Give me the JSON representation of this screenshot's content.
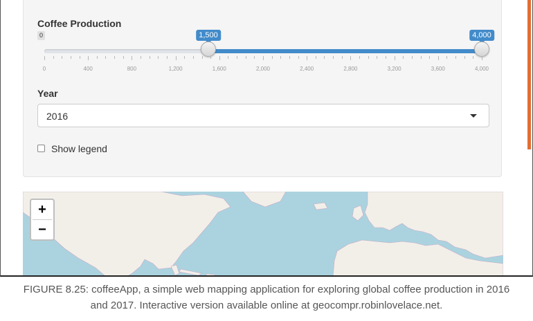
{
  "slider": {
    "label": "Coffee Production",
    "min_label": "0",
    "low_value": "1,500",
    "high_value": "4,000",
    "min": 0,
    "max": 4000,
    "low": 1500,
    "high": 4000,
    "tick_labels": [
      "0",
      "400",
      "800",
      "1,200",
      "1,600",
      "2,000",
      "2,400",
      "2,800",
      "3,200",
      "3,600",
      "4,000"
    ],
    "accent_color": "#428bca"
  },
  "year_select": {
    "label": "Year",
    "value": "2016"
  },
  "legend_checkbox": {
    "label": "Show legend",
    "checked": false
  },
  "map": {
    "zoom_in": "+",
    "zoom_out": "−",
    "water_color": "#aad3df",
    "land_color": "#f2efe9"
  },
  "caption": {
    "line1": "FIGURE 8.25: coffeeApp, a simple web mapping application for exploring global coffee production in 2016",
    "line2": "and 2017. Interactive version available online at geocompr.robinlovelace.net."
  }
}
